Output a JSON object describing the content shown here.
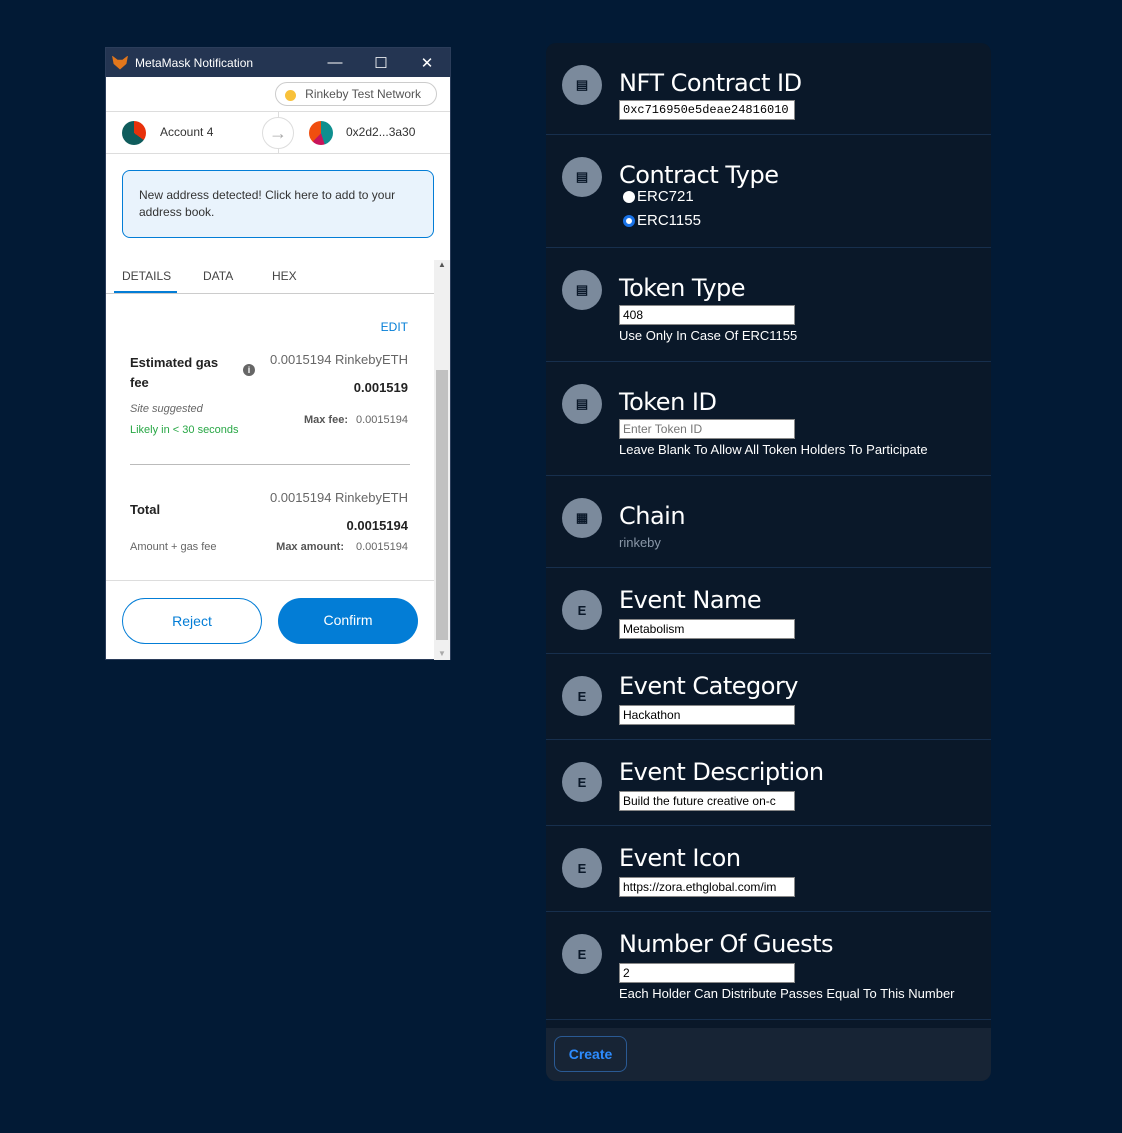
{
  "metamask": {
    "title": "MetaMask Notification",
    "window_controls": {
      "minimize": "—",
      "maximize": "☐",
      "close": "✕"
    },
    "network": "Rinkeby Test Network",
    "from_account": "Account 4",
    "to_address": "0x2d2...3a30",
    "notice": "New address detected! Click here to add to your address book.",
    "tabs": [
      "DETAILS",
      "DATA",
      "HEX"
    ],
    "edit": "EDIT",
    "gas": {
      "label": "Estimated gas fee",
      "eth": "0.0015194 RinkebyETH",
      "value": "0.001519",
      "site": "Site suggested",
      "likely": "Likely in < 30 seconds",
      "max_label": "Max fee:",
      "max_value": "0.0015194"
    },
    "total": {
      "label": "Total",
      "eth": "0.0015194 RinkebyETH",
      "value": "0.0015194",
      "sub": "Amount + gas fee",
      "max_label": "Max amount:",
      "max_value": "0.0015194"
    },
    "reject": "Reject",
    "confirm": "Confirm",
    "colors": {
      "accent": "#037dd6",
      "likely": "#28a745"
    }
  },
  "form": {
    "nft_contract": {
      "title": "NFT Contract ID",
      "value": "0xc716950e5deae24816010"
    },
    "contract_type": {
      "title": "Contract Type",
      "options": [
        "ERC721",
        "ERC1155"
      ],
      "selected": "ERC1155"
    },
    "token_type": {
      "title": "Token Type",
      "value": "408",
      "hint": "Use Only In Case Of ERC1155"
    },
    "token_id": {
      "title": "Token ID",
      "placeholder": "Enter Token ID",
      "hint": "Leave Blank To Allow All Token Holders To Participate"
    },
    "chain": {
      "title": "Chain",
      "value": "rinkeby"
    },
    "event_name": {
      "title": "Event Name",
      "value": "Metabolism",
      "icon": "E"
    },
    "event_category": {
      "title": "Event Category",
      "value": "Hackathon",
      "icon": "E"
    },
    "event_description": {
      "title": "Event Description",
      "value": "Build the future creative on-c",
      "icon": "E"
    },
    "event_icon": {
      "title": "Event Icon",
      "value": "https://zora.ethglobal.com/im",
      "icon": "E"
    },
    "guests": {
      "title": "Number Of Guests",
      "value": "2",
      "hint": "Each Holder Can Distribute Passes Equal To This Number",
      "icon": "E"
    },
    "create": "Create"
  }
}
